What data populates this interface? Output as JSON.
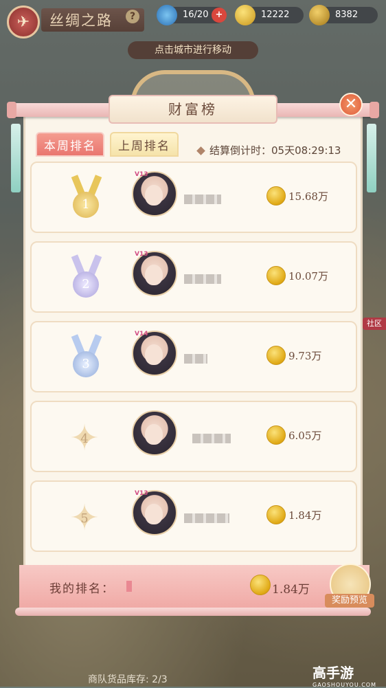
{
  "hud": {
    "title": "丝绸之路",
    "help": "?",
    "stamina": "16/20",
    "coins": "12222",
    "gold": "8382"
  },
  "hint": "点击城市进行移动",
  "panel": {
    "title": "财富榜",
    "tabs": [
      "本周排名",
      "上周排名"
    ],
    "countdown_label": "结算倒计时：",
    "countdown_value": "05天08:29:13"
  },
  "rankings": [
    {
      "rank": "1",
      "vip": "V13",
      "amount": "15.68万"
    },
    {
      "rank": "2",
      "vip": "V13",
      "amount": "10.07万"
    },
    {
      "rank": "3",
      "vip": "V14",
      "amount": "9.73万"
    },
    {
      "rank": "4",
      "vip": "",
      "amount": "6.05万"
    },
    {
      "rank": "5",
      "vip": "V13",
      "amount": "1.84万"
    }
  ],
  "my_rank": {
    "label": "我的排名：",
    "amount": "1.84万"
  },
  "reward_preview": "奖励预览",
  "stock": "商队货品库存: 2/3",
  "social": "社区",
  "watermark": {
    "brand": "高手游",
    "url": "GAOSHOUYOU.COM"
  },
  "colors": {
    "accent_pink": "#e9766f",
    "tab_yellow": "#f5e3aa",
    "panel_bg": "#fbf5ea",
    "coin_gold": "#e0a915"
  }
}
